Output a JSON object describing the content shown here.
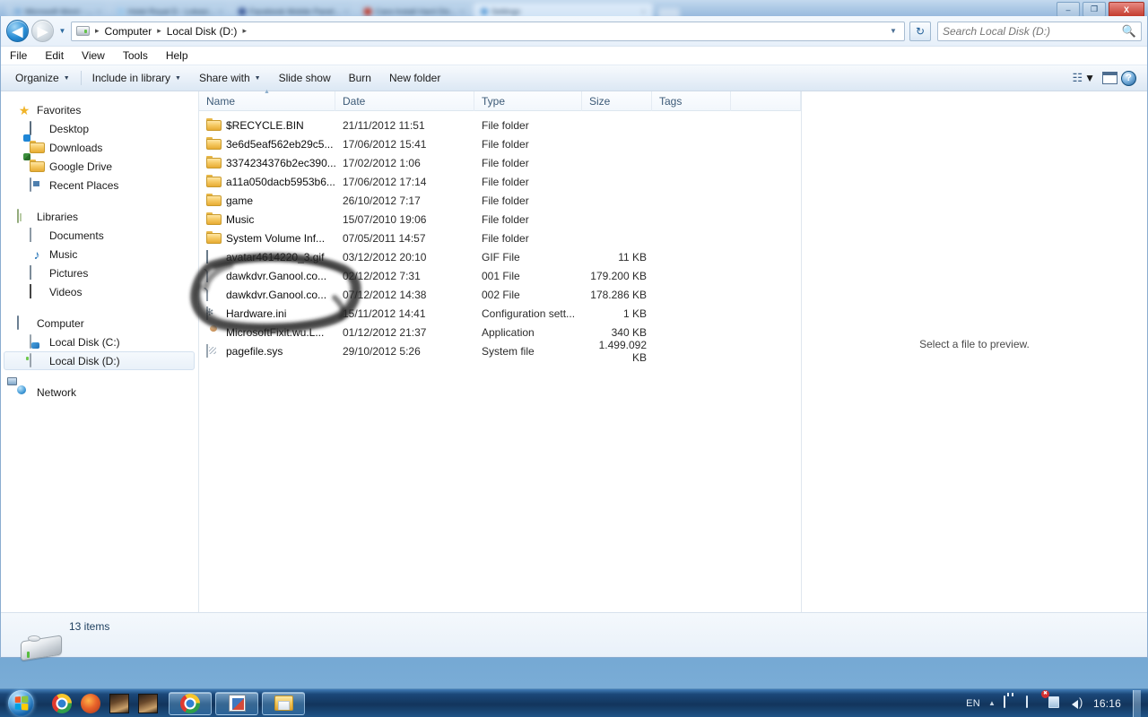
{
  "background_browser": {
    "tabs": [
      {
        "label": "Microsoft Word - ...",
        "color": "#8ab4dc",
        "active": false
      },
      {
        "label": "Hotel Royal D - Lokasi...",
        "color": "#9ec8ea",
        "active": false
      },
      {
        "label": "Facebook Mobile Panel...",
        "color": "#3b5998",
        "active": false
      },
      {
        "label": "Cara Install Hard Dis...",
        "color": "#c0392b",
        "active": false
      },
      {
        "label": "Settings",
        "color": "#5a9bd5",
        "active": true
      }
    ],
    "window_controls": {
      "minimize": "–",
      "restore": "❐",
      "close": "X"
    }
  },
  "explorer": {
    "address_bar": {
      "back_label": "◀",
      "forward_label": "▶",
      "history_dropdown": "▼",
      "breadcrumbs": [
        "Computer",
        "Local Disk (D:)"
      ],
      "separator": "▸",
      "crumb_dropdown": "▼",
      "refresh_label": "↻",
      "search_placeholder": "Search Local Disk (D:)",
      "search_value": "",
      "search_icon": "⚲"
    },
    "menu_bar": [
      "File",
      "Edit",
      "View",
      "Tools",
      "Help"
    ],
    "command_bar": {
      "items": [
        {
          "label": "Organize",
          "has_caret": true
        },
        {
          "label": "Include in library",
          "has_caret": true
        },
        {
          "label": "Share with",
          "has_caret": true
        },
        {
          "label": "Slide show",
          "has_caret": false
        },
        {
          "label": "Burn",
          "has_caret": false
        },
        {
          "label": "New folder",
          "has_caret": false
        }
      ],
      "view_caret": "▼",
      "view_glyph": "☷"
    },
    "nav_pane": {
      "groups": [
        {
          "header": {
            "label": "Favorites",
            "icon": "star-icon"
          },
          "items": [
            {
              "label": "Desktop",
              "icon": "desktop-icon"
            },
            {
              "label": "Downloads",
              "icon": "downloads-folder-icon"
            },
            {
              "label": "Google Drive",
              "icon": "google-drive-folder-icon"
            },
            {
              "label": "Recent Places",
              "icon": "recent-places-icon"
            }
          ]
        },
        {
          "header": {
            "label": "Libraries",
            "icon": "libraries-icon"
          },
          "items": [
            {
              "label": "Documents",
              "icon": "document-icon"
            },
            {
              "label": "Music",
              "icon": "music-note-icon"
            },
            {
              "label": "Pictures",
              "icon": "picture-icon"
            },
            {
              "label": "Videos",
              "icon": "video-icon"
            }
          ]
        },
        {
          "header": {
            "label": "Computer",
            "icon": "computer-icon"
          },
          "items": [
            {
              "label": "Local Disk (C:)",
              "icon": "hard-disk-c-icon",
              "selected": false
            },
            {
              "label": "Local Disk (D:)",
              "icon": "hard-disk-d-icon",
              "selected": true
            }
          ]
        },
        {
          "header": {
            "label": "Network",
            "icon": "network-icon"
          },
          "items": []
        }
      ]
    },
    "file_list": {
      "columns": [
        "Name",
        "Date",
        "Type",
        "Size",
        "Tags"
      ],
      "sorted_column": "Name",
      "rows": [
        {
          "name": "$RECYCLE.BIN",
          "date": "21/11/2012 11:51",
          "type": "File folder",
          "size": "",
          "tags": "",
          "icon": "folder-icon"
        },
        {
          "name": "3e6d5eaf562eb29c5...",
          "date": "17/06/2012 15:41",
          "type": "File folder",
          "size": "",
          "tags": "",
          "icon": "folder-icon"
        },
        {
          "name": "3374234376b2ec390...",
          "date": "17/02/2012 1:06",
          "type": "File folder",
          "size": "",
          "tags": "",
          "icon": "folder-icon"
        },
        {
          "name": "a11a050dacb5953b6...",
          "date": "17/06/2012 17:14",
          "type": "File folder",
          "size": "",
          "tags": "",
          "icon": "folder-icon"
        },
        {
          "name": "game",
          "date": "26/10/2012 7:17",
          "type": "File folder",
          "size": "",
          "tags": "",
          "icon": "folder-icon"
        },
        {
          "name": "Music",
          "date": "15/07/2010 19:06",
          "type": "File folder",
          "size": "",
          "tags": "",
          "icon": "folder-icon"
        },
        {
          "name": "System Volume Inf...",
          "date": "07/05/2011 14:57",
          "type": "File folder",
          "size": "",
          "tags": "",
          "icon": "folder-icon"
        },
        {
          "name": "avatar4614220_3.gif",
          "date": "03/12/2012 20:10",
          "type": "GIF File",
          "size": "11 KB",
          "tags": "",
          "icon": "gif-file-icon"
        },
        {
          "name": "dawkdvr.Ganool.co...",
          "date": "02/12/2012 7:31",
          "type": "001 File",
          "size": "179.200 KB",
          "tags": "",
          "icon": "generic-file-icon"
        },
        {
          "name": "dawkdvr.Ganool.co...",
          "date": "07/12/2012 14:38",
          "type": "002 File",
          "size": "178.286 KB",
          "tags": "",
          "icon": "generic-file-icon"
        },
        {
          "name": "Hardware.ini",
          "date": "15/11/2012 14:41",
          "type": "Configuration sett...",
          "size": "1 KB",
          "tags": "",
          "icon": "ini-file-icon"
        },
        {
          "name": "MicrosoftFixit.wu.L...",
          "date": "01/12/2012 21:37",
          "type": "Application",
          "size": "340 KB",
          "tags": "",
          "icon": "application-icon"
        },
        {
          "name": "pagefile.sys",
          "date": "29/10/2012 5:26",
          "type": "System file",
          "size": "1.499.092 KB",
          "tags": "",
          "icon": "system-file-icon"
        }
      ]
    },
    "preview_pane": {
      "message": "Select a file to preview."
    },
    "status_bar": {
      "item_count": "13 items"
    },
    "annotation": {
      "shape": "hand-drawn-ellipse",
      "color": "#2b2b2b"
    }
  },
  "taskbar": {
    "start_label": "Start",
    "quick_launch": [
      {
        "name": "chrome-icon"
      },
      {
        "name": "firefox-icon"
      },
      {
        "name": "photo-thumbnail-icon"
      },
      {
        "name": "photo-thumbnail-icon"
      }
    ],
    "running": [
      {
        "name": "chrome-window"
      },
      {
        "name": "excel-window"
      },
      {
        "name": "explorer-window"
      }
    ],
    "tray": {
      "language": "EN",
      "show_hidden": "▲",
      "icons": [
        "power-plug-icon",
        "display-icon",
        "network-error-icon",
        "volume-icon"
      ],
      "clock": "16:16"
    }
  }
}
